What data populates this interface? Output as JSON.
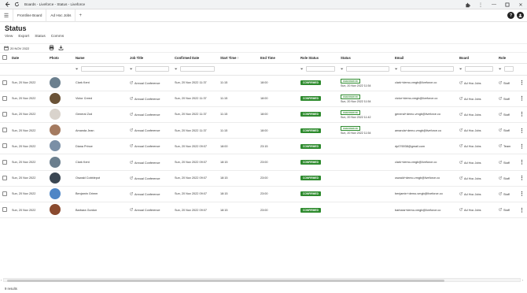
{
  "window": {
    "title": "Boards - Liveforce - Status - Liveforce",
    "icons": [
      "back-icon",
      "refresh-icon",
      "extensions-icon",
      "kebab-menu-icon",
      "minimize-icon",
      "maximize-icon",
      "close-icon"
    ]
  },
  "tabs": [
    {
      "label": "Frontline Board"
    },
    {
      "label": "Ad Hoc Jobs"
    }
  ],
  "tab_add": "+",
  "header_buttons": {
    "help": "?",
    "user": "●"
  },
  "page": {
    "title": "Status"
  },
  "menu": [
    {
      "label": "View"
    },
    {
      "label": "Export"
    },
    {
      "label": "Status"
    },
    {
      "label": "Comms"
    }
  ],
  "toolbar": {
    "date": "20 NOV 2022"
  },
  "columns": {
    "date": "Date",
    "photo": "Photo",
    "name": "Name",
    "job_title": "Job Title",
    "confirmed_date": "Confirmed Date",
    "start_time": "Start Time",
    "end_time": "End Time",
    "role_status": "Role Status",
    "status": "Status",
    "email": "Email",
    "board": "Board",
    "role": "Role"
  },
  "rows": [
    {
      "date": "Sun, 20 Nov 2022",
      "name": "Clark Kent",
      "job": "Annual Conference",
      "confirmed": "Sun, 20 Nov 2022 11:37",
      "start": "11:15",
      "end": "18:00",
      "role_status": "CONFIRMED",
      "status_badge": "CHECKED IN",
      "status_time": "Sun, 20 Nov 2022 11:54",
      "email": "clark+demo-vmgb@liveforce.co",
      "board": "Ad Hoc Jobs",
      "role": "Staff",
      "avatar_color": "#6b7f8e"
    },
    {
      "date": "Sun, 20 Nov 2022",
      "name": "Victor Creed",
      "job": "Annual Conference",
      "confirmed": "Sun, 20 Nov 2022 11:37",
      "start": "11:15",
      "end": "18:00",
      "role_status": "CONFIRMED",
      "status_badge": "CHECKED IN",
      "status_time": "Sun, 20 Nov 2022 11:54",
      "email": "victor+demo-vmgb@liveforce.co",
      "board": "Ad Hoc Jobs",
      "role": "Staff",
      "avatar_color": "#6a5236"
    },
    {
      "date": "Sun, 20 Nov 2022",
      "name": "General Zod",
      "job": "Annual Conference",
      "confirmed": "Sun, 20 Nov 2022 11:37",
      "start": "11:15",
      "end": "18:00",
      "role_status": "CONFIRMED",
      "status_badge": "CHECKED IN",
      "status_time": "Sun, 20 Nov 2022 11:42",
      "email": "general+demo-vmgb@liveforce.co",
      "board": "Ad Hoc Jobs",
      "role": "Staff",
      "avatar_color": "#d9d3cc"
    },
    {
      "date": "Sun, 20 Nov 2022",
      "name": "Amanda Jean",
      "job": "Annual Conference",
      "confirmed": "Sun, 20 Nov 2022 11:37",
      "start": "11:15",
      "end": "18:00",
      "role_status": "CONFIRMED",
      "status_badge": "CHECKED IN",
      "status_time": "Sun, 20 Nov 2022 11:54",
      "email": "amanda+demo-vmgb@liveforce.co",
      "board": "Ad Hoc Jobs",
      "role": "Staff",
      "avatar_color": "#a47a5f"
    },
    {
      "date": "Sun, 20 Nov 2022",
      "name": "Diana Prince",
      "job": "Annual Conference",
      "confirmed": "Sun, 20 Nov 2022 09:07",
      "start": "18:00",
      "end": "23:15",
      "role_status": "CONFIRMED",
      "status_badge": "",
      "status_time": "",
      "email": "dp076938@gmail.com",
      "board": "Ad Hoc Jobs",
      "role": "Team",
      "avatar_color": "#7a8fa6"
    },
    {
      "date": "Sun, 20 Nov 2022",
      "name": "Clark Kent",
      "job": "Annual Conference",
      "confirmed": "Sun, 20 Nov 2022 09:07",
      "start": "18:15",
      "end": "23:00",
      "role_status": "CONFIRMED",
      "status_badge": "",
      "status_time": "",
      "email": "clark+demo-vmgb@liveforce.co",
      "board": "Ad Hoc Jobs",
      "role": "Staff",
      "avatar_color": "#6b7f8e"
    },
    {
      "date": "Sun, 20 Nov 2022",
      "name": "Oswald Cobblepot",
      "job": "Annual Conference",
      "confirmed": "Sun, 20 Nov 2022 09:07",
      "start": "18:15",
      "end": "23:00",
      "role_status": "CONFIRMED",
      "status_badge": "",
      "status_time": "",
      "email": "oswald+demo-vmgb@liveforce.co",
      "board": "Ad Hoc Jobs",
      "role": "Staff",
      "avatar_color": "#3a4652"
    },
    {
      "date": "Sun, 20 Nov 2022",
      "name": "Benjamin Grimm",
      "job": "Annual Conference",
      "confirmed": "Sun, 20 Nov 2022 09:07",
      "start": "18:15",
      "end": "23:00",
      "role_status": "CONFIRMED",
      "status_badge": "",
      "status_time": "",
      "email": "benjamin+demo-vmgb@liveforce.co",
      "board": "Ad Hoc Jobs",
      "role": "Staff",
      "avatar_color": "#4f86c6"
    },
    {
      "date": "Sun, 20 Nov 2022",
      "name": "Barbara Gordon",
      "job": "Annual Conference",
      "confirmed": "Sun, 20 Nov 2022 09:07",
      "start": "18:15",
      "end": "23:00",
      "role_status": "CONFIRMED",
      "status_badge": "",
      "status_time": "",
      "email": "barbara+demo-vmgb@liveforce.co",
      "board": "Ad Hoc Jobs",
      "role": "Staff",
      "avatar_color": "#8a4a2e"
    }
  ],
  "footer": {
    "results": "9 results"
  },
  "colors": {
    "confirmed": "#2e8b2e",
    "checked_in": "#2e8b2e"
  }
}
